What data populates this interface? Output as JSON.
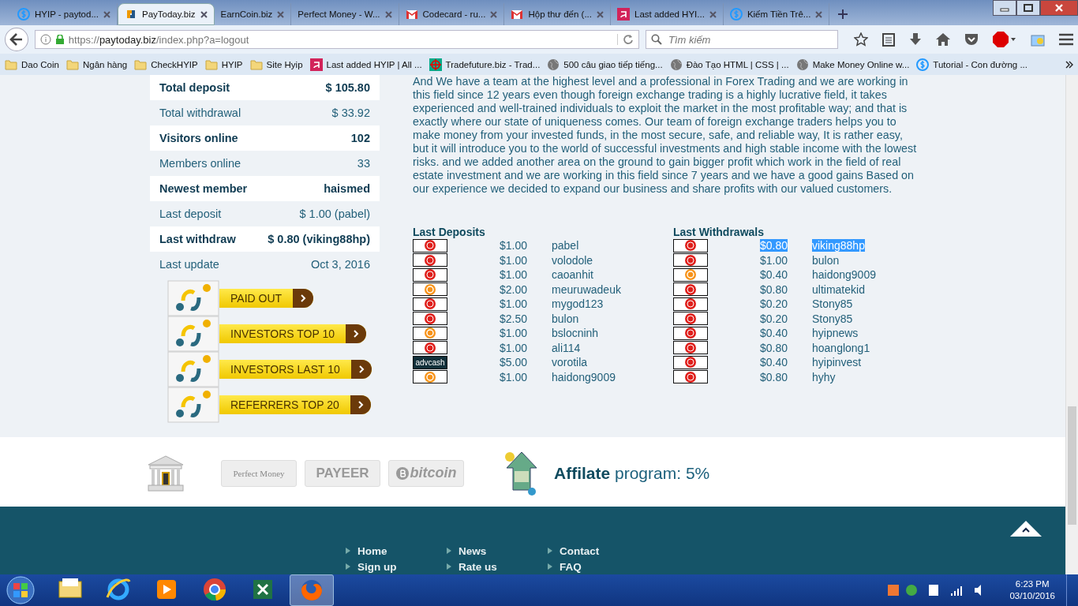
{
  "browser": {
    "tabs": [
      {
        "title": "HYIP - paytod...",
        "kind": "dollar",
        "selected": false
      },
      {
        "title": "PayToday.biz",
        "kind": "arrows",
        "selected": true
      },
      {
        "title": "EarnCoin.biz",
        "kind": "plain",
        "selected": false
      },
      {
        "title": "Perfect Money - W...",
        "kind": "plain",
        "selected": false
      },
      {
        "title": "Codecard - ru...",
        "kind": "mail",
        "selected": false
      },
      {
        "title": "Hộp thư đến (...",
        "kind": "mail",
        "selected": false
      },
      {
        "title": "Last added HYI...",
        "kind": "a",
        "selected": false
      },
      {
        "title": "Kiếm Tiền Trê...",
        "kind": "dollar",
        "selected": false
      }
    ],
    "url_prefix": "https://",
    "url_host": "paytoday.biz",
    "url_path": "/index.php?a=logout",
    "search": {
      "placeholder": "Tìm kiếm"
    },
    "bookmarks": [
      {
        "label": "Dao Coin",
        "kind": "folder"
      },
      {
        "label": "Ngân hàng",
        "kind": "folder"
      },
      {
        "label": "CheckHYIP",
        "kind": "folder"
      },
      {
        "label": "HYIP",
        "kind": "folder"
      },
      {
        "label": "Site Hyip",
        "kind": "folder"
      },
      {
        "label": "Last added HYIP | All ...",
        "kind": "a"
      },
      {
        "label": "Tradefuture.biz - Trad...",
        "kind": "target"
      },
      {
        "label": "500 câu giao tiếp tiếng...",
        "kind": "globe"
      },
      {
        "label": "Đào Tạo HTML | CSS | ...",
        "kind": "globe"
      },
      {
        "label": "Make Money Online w...",
        "kind": "globe"
      },
      {
        "label": "Tutorial - Con đường ...",
        "kind": "dollar"
      }
    ]
  },
  "stats": [
    {
      "label": "Total deposit",
      "value": "$ 105.80"
    },
    {
      "label": "Total withdrawal",
      "value": "$ 33.92"
    },
    {
      "label": "Visitors online",
      "value": "102"
    },
    {
      "label": "Members online",
      "value": "33"
    },
    {
      "label": "Newest member",
      "value": "haismed"
    },
    {
      "label": "Last deposit",
      "value": "$ 1.00 (pabel)"
    },
    {
      "label": "Last withdraw",
      "value": "$ 0.80 (viking88hp)"
    },
    {
      "label": "Last update",
      "value": "Oct 3, 2016"
    }
  ],
  "menu_buttons": [
    "PAID OUT",
    "INVESTORS TOP 10",
    "INVESTORS LAST 10",
    "REFERRERS TOP 20"
  ],
  "about": "And We have a team at the highest level and a professional in Forex Trading and we are working in this field since 12 years even though foreign exchange trading is a highly lucrative field, it takes experienced and well-trained individuals to exploit the market in the most profitable way; and that is exactly where our state of uniqueness comes. Our team of foreign exchange traders helps you to make money from your invested funds, in the most secure, safe, and reliable way, It is rather easy, but it will introduce you to the world of successful investments and high stable income with the lowest risks. and we added another area on the ground to gain bigger profit which work in the field of real estate investment and we are working in this field since 7 years and we have a good gains Based on our experience we decided to expand our business and share profits with our valued customers.",
  "last_deposits": {
    "title": "Last Deposits",
    "rows": [
      {
        "kind": "pm",
        "amount": "$1.00",
        "user": "pabel"
      },
      {
        "kind": "pm",
        "amount": "$1.00",
        "user": "volodole"
      },
      {
        "kind": "pm",
        "amount": "$1.00",
        "user": "caoanhit"
      },
      {
        "kind": "bitcoin",
        "amount": "$2.00",
        "user": "meuruwadeuk"
      },
      {
        "kind": "pm",
        "amount": "$1.00",
        "user": "mygod123"
      },
      {
        "kind": "pm",
        "amount": "$2.50",
        "user": "bulon"
      },
      {
        "kind": "bitcoin",
        "amount": "$1.00",
        "user": "bslocninh"
      },
      {
        "kind": "pm",
        "amount": "$1.00",
        "user": "ali114"
      },
      {
        "kind": "advcash",
        "logo": "advcash",
        "amount": "$5.00",
        "user": "vorotila"
      },
      {
        "kind": "bitcoin",
        "amount": "$1.00",
        "user": "haidong9009"
      }
    ]
  },
  "last_withdrawals": {
    "title": "Last Withdrawals",
    "rows": [
      {
        "kind": "pm",
        "amount": "$0.80",
        "user": "viking88hp",
        "highlighted": true
      },
      {
        "kind": "pm",
        "amount": "$1.00",
        "user": "bulon",
        "highlighted": false
      },
      {
        "kind": "bitcoin",
        "amount": "$0.40",
        "user": "haidong9009",
        "highlighted": false
      },
      {
        "kind": "pm",
        "amount": "$0.80",
        "user": "ultimatekid",
        "highlighted": false
      },
      {
        "kind": "pm",
        "amount": "$0.20",
        "user": "Stony85",
        "highlighted": false
      },
      {
        "kind": "pm",
        "amount": "$0.20",
        "user": "Stony85",
        "highlighted": false
      },
      {
        "kind": "pm",
        "amount": "$0.40",
        "user": "hyipnews",
        "highlighted": false
      },
      {
        "kind": "pm",
        "amount": "$0.80",
        "user": "hoanglong1",
        "highlighted": false
      },
      {
        "kind": "pm",
        "amount": "$0.40",
        "user": "hyipinvest",
        "highlighted": false
      },
      {
        "kind": "pm",
        "amount": "$0.80",
        "user": "hyhy",
        "highlighted": false
      }
    ]
  },
  "payment_logos": [
    {
      "kind": "pm",
      "text": "Perfect Money"
    },
    {
      "kind": "payeer",
      "text": "PAYEER"
    },
    {
      "kind": "bitcoin",
      "text": "bitcoin"
    }
  ],
  "affiliate": "**Affilate** program: 5%",
  "footer_links": [
    [
      "Home",
      "Sign up"
    ],
    [
      "News",
      "Rate us"
    ],
    [
      "Contact",
      "FAQ"
    ]
  ],
  "taskbar": {
    "apps": [
      {
        "kind": "folder",
        "active": false
      },
      {
        "kind": "ie",
        "active": false
      },
      {
        "kind": "media",
        "active": false
      },
      {
        "kind": "chrome",
        "active": false
      },
      {
        "kind": "excel",
        "active": false
      },
      {
        "kind": "firefox",
        "active": true
      }
    ],
    "time": "6:23 PM",
    "date": "03/10/2016"
  }
}
